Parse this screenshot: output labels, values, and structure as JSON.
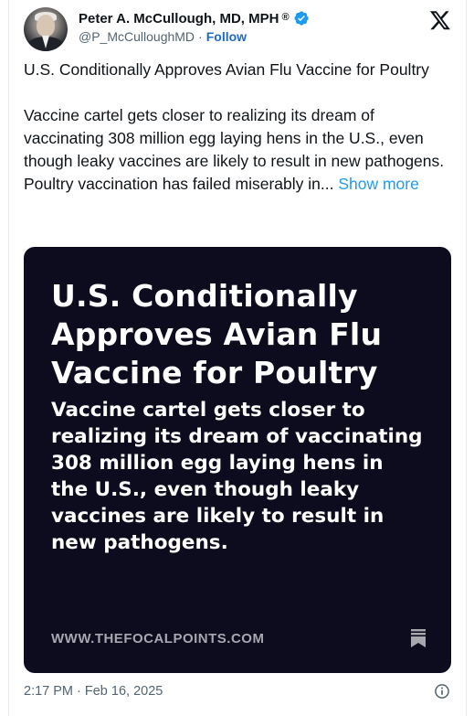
{
  "author": {
    "display_name": "Peter A. McCullough, MD, MPH",
    "reg_mark": "®",
    "handle": "@P_McCulloughMD",
    "separator": "·",
    "follow_label": "Follow",
    "verified": true
  },
  "tweet": {
    "paragraph1": "U.S. Conditionally Approves Avian Flu Vaccine for Poultry",
    "paragraph2": "Vaccine cartel gets closer to realizing its dream of vaccinating 308 million egg laying hens in the U.S., even though leaky vaccines are likely to result in new pathogens.  Poultry vaccination has failed miserably in...",
    "show_more_label": "Show more"
  },
  "card": {
    "title": "U.S. Conditionally Approves Avian Flu Vaccine for Poultry",
    "subtitle": "Vaccine cartel gets closer to realizing its dream of vaccinating 308 million egg laying hens in the U.S., even though leaky vaccines are likely to result in new pathogens.",
    "domain": "WWW.THEFOCALPOINTS.COM",
    "background": "#0d0b1e"
  },
  "footer": {
    "timestamp": "2:17 PM · Feb 16, 2025"
  },
  "icons": {
    "verified": "verified-badge-icon",
    "platform": "x-logo-icon",
    "bookmark": "bookmark-icon",
    "info": "info-icon"
  },
  "colors": {
    "accent": "#1d9bf0",
    "follow": "#1d6ac9",
    "muted": "#536471",
    "text": "#0f1419"
  }
}
